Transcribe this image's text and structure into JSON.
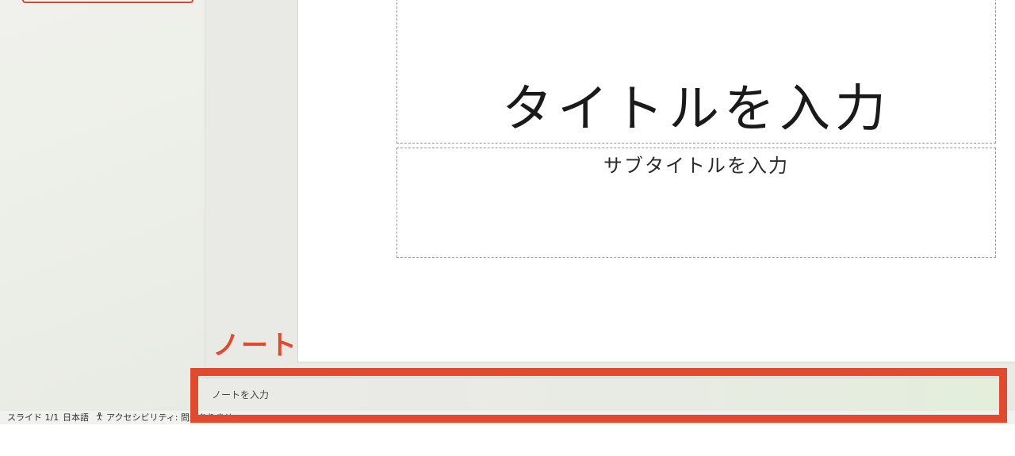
{
  "slide": {
    "title_placeholder": "タイトルを入力",
    "subtitle_placeholder": "サブタイトルを入力"
  },
  "annotation": {
    "label": "ノート",
    "color": "#e04a2e"
  },
  "notes": {
    "placeholder": "ノートを入力"
  },
  "status_bar": {
    "slide_counter": "スライド 1/1",
    "language": "日本語",
    "accessibility": "アクセシビリティ: 問題ありませ"
  }
}
